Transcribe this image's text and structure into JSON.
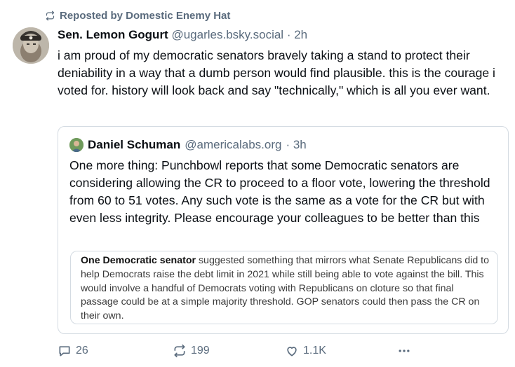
{
  "repost": {
    "label": "Reposted by Domestic Enemy Hat"
  },
  "post": {
    "author_name": "Sen. Lemon Gogurt",
    "author_handle": "@ugarles.bsky.social",
    "timestamp": "· 2h",
    "text": "i am proud of my democratic senators bravely taking a stand to protect their deniability in a way that a dumb person would find plausible. this is the courage i voted for. history will look back and say \"technically,\" which is all you ever want."
  },
  "quote": {
    "author_name": "Daniel Schuman",
    "author_handle": "@americalabs.org",
    "timestamp": "· 3h",
    "text": "One more thing: Punchbowl reports that some Democratic senators are considering allowing the CR to proceed to a floor vote, lowering the threshold from 60 to 51 votes. Any such vote is the same as a vote for the CR but with even less integrity. Please encourage your colleagues to be better than this",
    "image": {
      "bold_lead": "One Democratic senator",
      "rest": " suggested something that mirrors what Senate Republicans did to help Democrats raise the debt limit in 2021 while still being able to vote against the bill. This would involve a handful of Democrats voting with Republicans on cloture so that final passage could be at a simple majority threshold. GOP senators could then pass the CR on their own."
    }
  },
  "actions": {
    "replies": "26",
    "reposts": "199",
    "likes": "1.1K"
  },
  "icons": [
    "repost-icon",
    "reply-icon",
    "like-icon",
    "more-icon"
  ],
  "colors": {
    "muted": "#5a6b7d",
    "border": "#d4dbe2",
    "text": "#0b0f14"
  }
}
